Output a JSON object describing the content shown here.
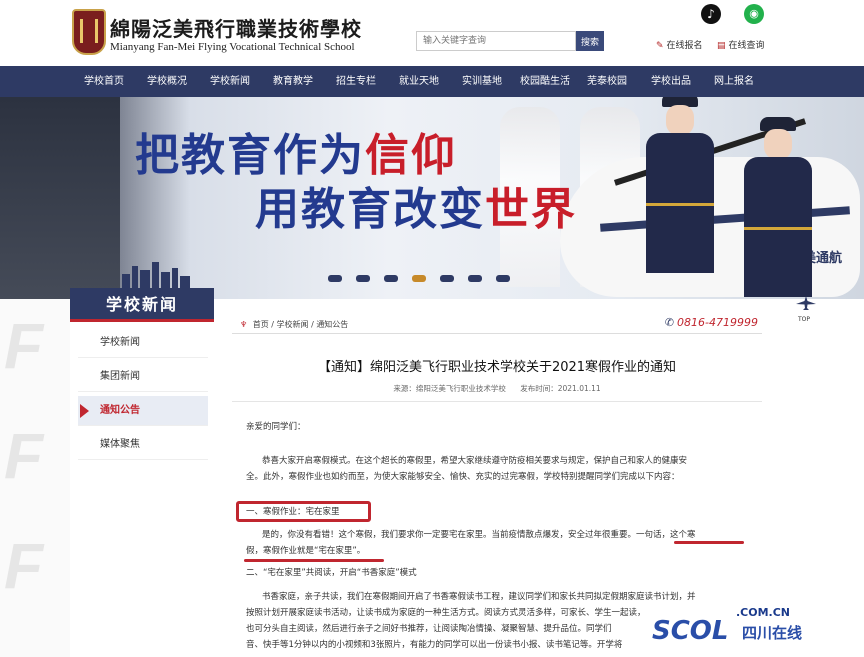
{
  "header": {
    "school_name_cn": "綿陽泛美飛行職業技術學校",
    "school_name_en": "Mianyang Fan-Mei Flying Vocational Technical School",
    "search_placeholder": "输入关键字查询",
    "search_button": "搜索",
    "online_apply": "在线报名",
    "online_query": "在线查询",
    "social": [
      "tiktok-icon",
      "wechat-icon"
    ]
  },
  "nav": {
    "items": [
      "学校首页",
      "学校概况",
      "学校新闻",
      "教育教学",
      "招生专栏",
      "就业天地",
      "实训基地",
      "校园酷生活",
      "芜泰校园",
      "学校出品",
      "网上报名"
    ]
  },
  "banner": {
    "slogan_line1_a": "把教育作为",
    "slogan_line1_b": "信仰",
    "slogan_line2_a": "用教育改变",
    "slogan_line2_b": "世界",
    "helicopter_text": "泛美通航",
    "slide_count": 7,
    "active_slide": 3
  },
  "sidebar": {
    "title": "学校新闻",
    "items": [
      {
        "label": "学校新闻",
        "active": false
      },
      {
        "label": "集团新闻",
        "active": false
      },
      {
        "label": "通知公告",
        "active": true
      },
      {
        "label": "媒体聚焦",
        "active": false
      }
    ]
  },
  "breadcrumb": {
    "home": "首页",
    "sep": "/",
    "level1": "学校新闻",
    "level2": "通知公告"
  },
  "phone": "0816-4719999",
  "article": {
    "title": "【通知】绵阳泛美飞行职业技术学校关于2021寒假作业的通知",
    "source": "来源：绵阳泛美飞行职业技术学校",
    "publish_time": "发布时间：2021.01.11",
    "greeting": "亲爱的同学们：",
    "para1_line1": "恭喜大家开启寒假模式。在这个超长的寒假里，希望大家继续遵守防疫相关要求与规定，保护自己和家人的健康安",
    "para1_line2": "全。此外，寒假作业也如约而至，为使大家能够安全、愉快、充实的过完寒假，学校特别提醒同学们完成以下内容：",
    "section1": "一、寒假作业：宅在家里",
    "para2_line1": "是的，你没有看错！这个寒假，我们要求你一定要宅在家里。当前疫情散点爆发，安全过年很重要。一句话，这个寒",
    "para2_line2": "假，寒假作业就是“宅在家里”。",
    "section2": "二、“宅在家里”共阅读，开启“书香家庭”模式",
    "para3_line1": "书香家庭，亲子共读，我们在寒假期间开启了书香寒假读书工程，建议同学们和家长共同拟定假期家庭读书计划，并",
    "para3_line2": "按照计划开展家庭读书活动，让读书成为家庭的一种生活方式。阅读方式灵活多样，可家长、学生一起读，",
    "para3_line3": "也可分头自主阅读，然后进行亲子之间好书推荐，让阅读陶冶情操、凝聚智慧、提升品位。同学们",
    "para3_line4": "音、快手等1分钟以内的小视频和3张照片，有能力的同学可以出一份读书小报、读书笔记等。开学将"
  },
  "right": {
    "top_label": "TOP"
  },
  "watermark": {
    "domain": ".COM.CN",
    "brand": "SCOL",
    "name": "四川在线"
  }
}
